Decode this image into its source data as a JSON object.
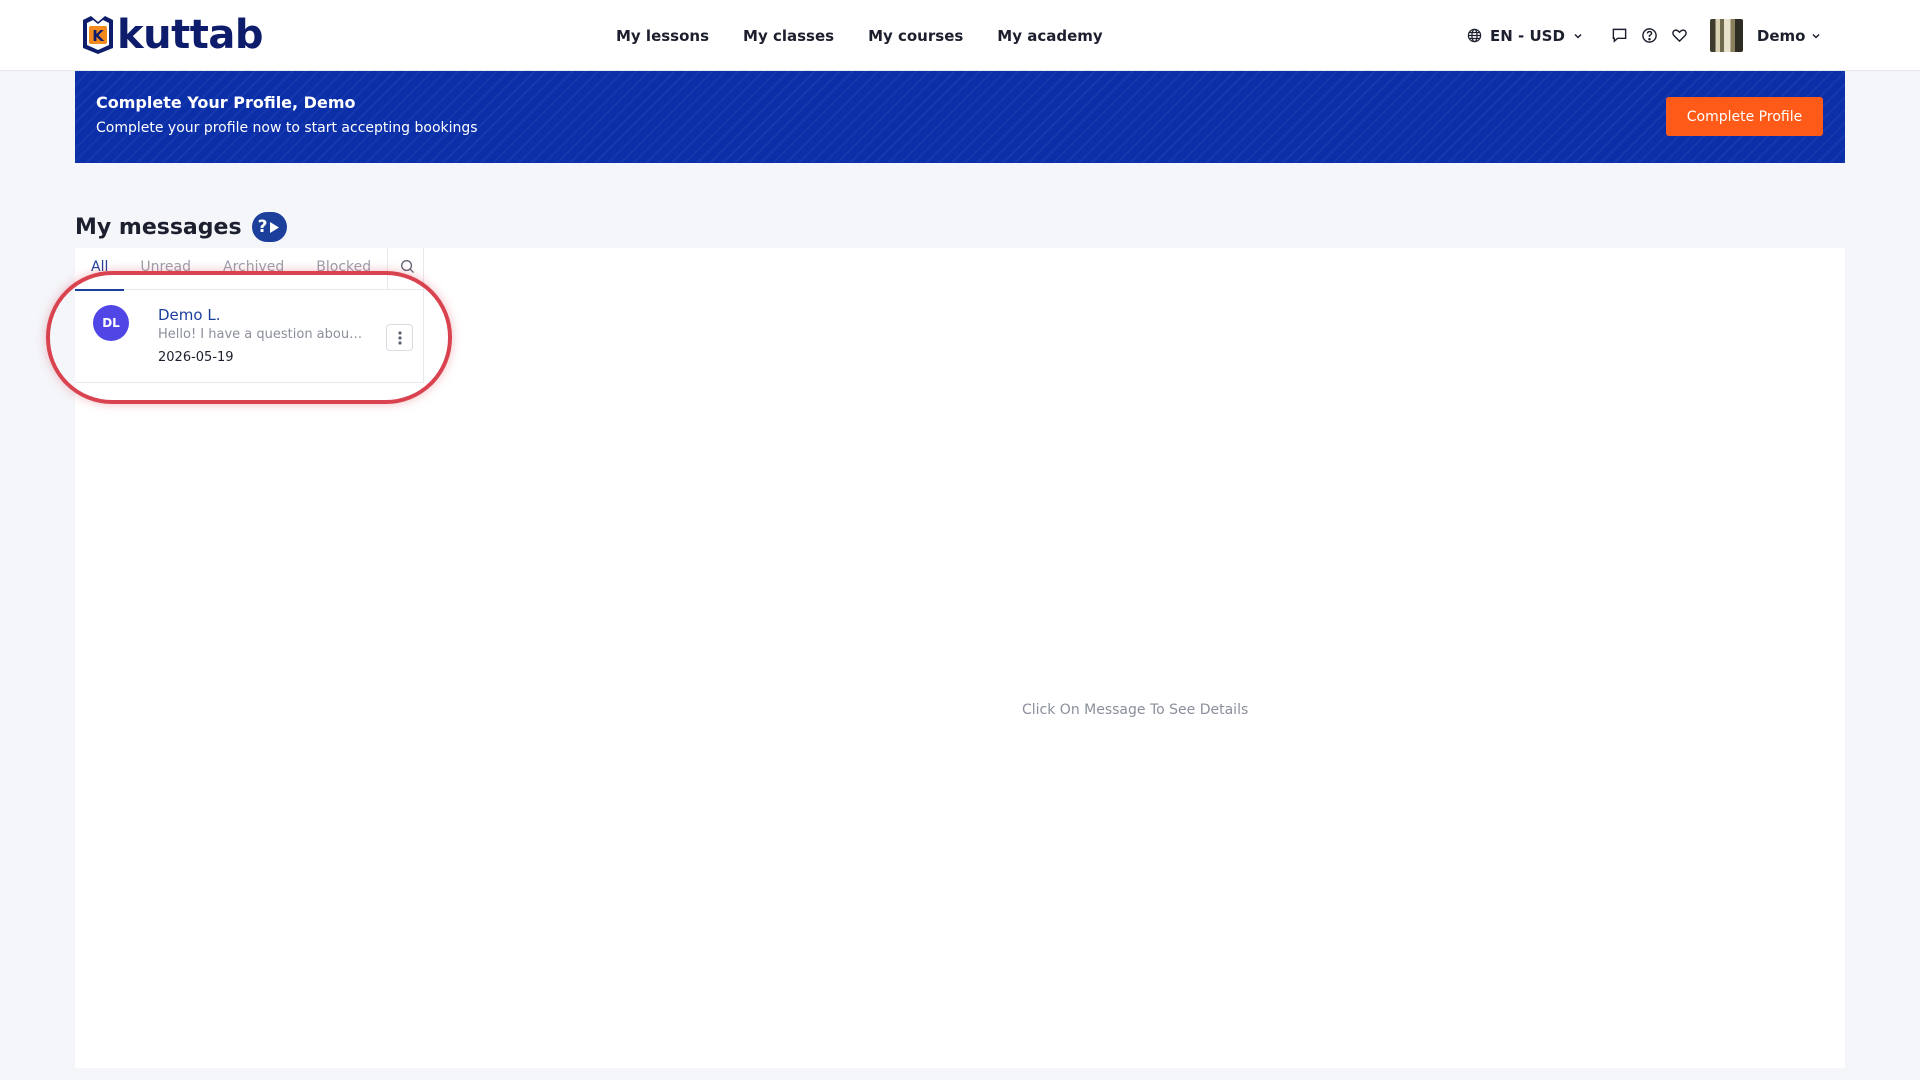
{
  "brand": {
    "name": "kuttab",
    "mark_letter": "K"
  },
  "nav": {
    "items": [
      "My lessons",
      "My classes",
      "My courses",
      "My academy"
    ]
  },
  "header": {
    "language_currency": "EN - USD",
    "user_name": "Demo",
    "icons": [
      "globe-icon",
      "message-icon",
      "help-icon",
      "heart-icon",
      "chevron-down-icon"
    ]
  },
  "banner": {
    "title": "Complete Your Profile, Demo",
    "subtitle": "Complete your profile now to start accepting bookings",
    "button_label": "Complete Profile"
  },
  "page": {
    "title": "My messages",
    "help_symbol": "?"
  },
  "messages": {
    "tabs": [
      "All",
      "Unread",
      "Archived",
      "Blocked"
    ],
    "active_tab": "All",
    "conversations": [
      {
        "initials": "DL",
        "name": "Demo L.",
        "preview": "Hello! I have a question about the course",
        "date": "2026-05-19"
      }
    ],
    "empty_detail_text": "Click On Message To See Details"
  },
  "colors": {
    "brand_navy": "#0e1d6b",
    "banner_blue": "#0b2fa9",
    "accent_orange": "#ff5a17",
    "link_blue": "#1d3f9c",
    "avatar_purple": "#4f46e5",
    "highlight_red": "#d9434f"
  }
}
